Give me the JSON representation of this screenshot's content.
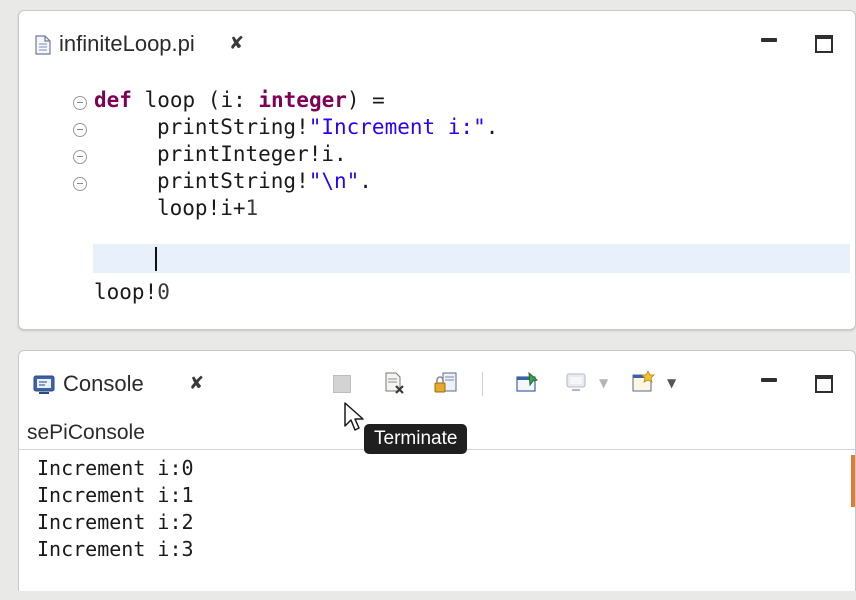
{
  "editor": {
    "tab_title": "infiniteLoop.pi",
    "close_glyph": "✘",
    "code": {
      "line1_kw": "def",
      "line1_a": " loop (i: ",
      "line1_type": "integer",
      "line1_b": ") =",
      "line2_fn": "printString!",
      "line2_str": "\"Increment i:\"",
      "line2_end": ".",
      "line3": "printInteger!i.",
      "line4_fn": "printString!",
      "line4_str": "\"\\n\"",
      "line4_end": ".",
      "line5_fn": "loop!i+",
      "line5_num": "1",
      "line7_fn": "loop!",
      "line7_num": "0"
    }
  },
  "console": {
    "tab_title": "Console",
    "close_glyph": "✘",
    "name": "sePiConsole",
    "output": [
      "Increment i:0",
      "Increment i:1",
      "Increment i:2",
      "Increment i:3"
    ],
    "toolbar_icons": [
      "terminate-icon",
      "remove-launch-icon",
      "scroll-lock-icon",
      "pin-console-icon",
      "display-console-icon",
      "open-console-icon"
    ]
  },
  "tooltip": {
    "text": "Terminate"
  },
  "colors": {
    "keyword": "#7f0055",
    "string": "#2a00ff",
    "current_line": "#e8f0fb",
    "overview_marker": "#e07b39",
    "tooltip_bg": "#1f1f1f"
  }
}
